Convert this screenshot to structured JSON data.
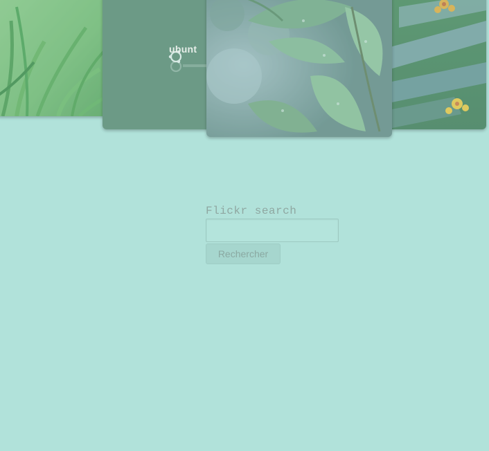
{
  "gallery": {
    "photos": [
      {
        "subject": "grass"
      },
      {
        "subject": "ubuntu-wallpaper",
        "wordmark": "ubunt"
      },
      {
        "subject": "leaves"
      },
      {
        "subject": "flowers"
      }
    ]
  },
  "search": {
    "label": "Flickr search",
    "input_value": "",
    "button_label": "Rechercher"
  },
  "colors": {
    "background": "#b1e2da",
    "label": "#8fa7a1",
    "button": "#a6d6ce"
  }
}
